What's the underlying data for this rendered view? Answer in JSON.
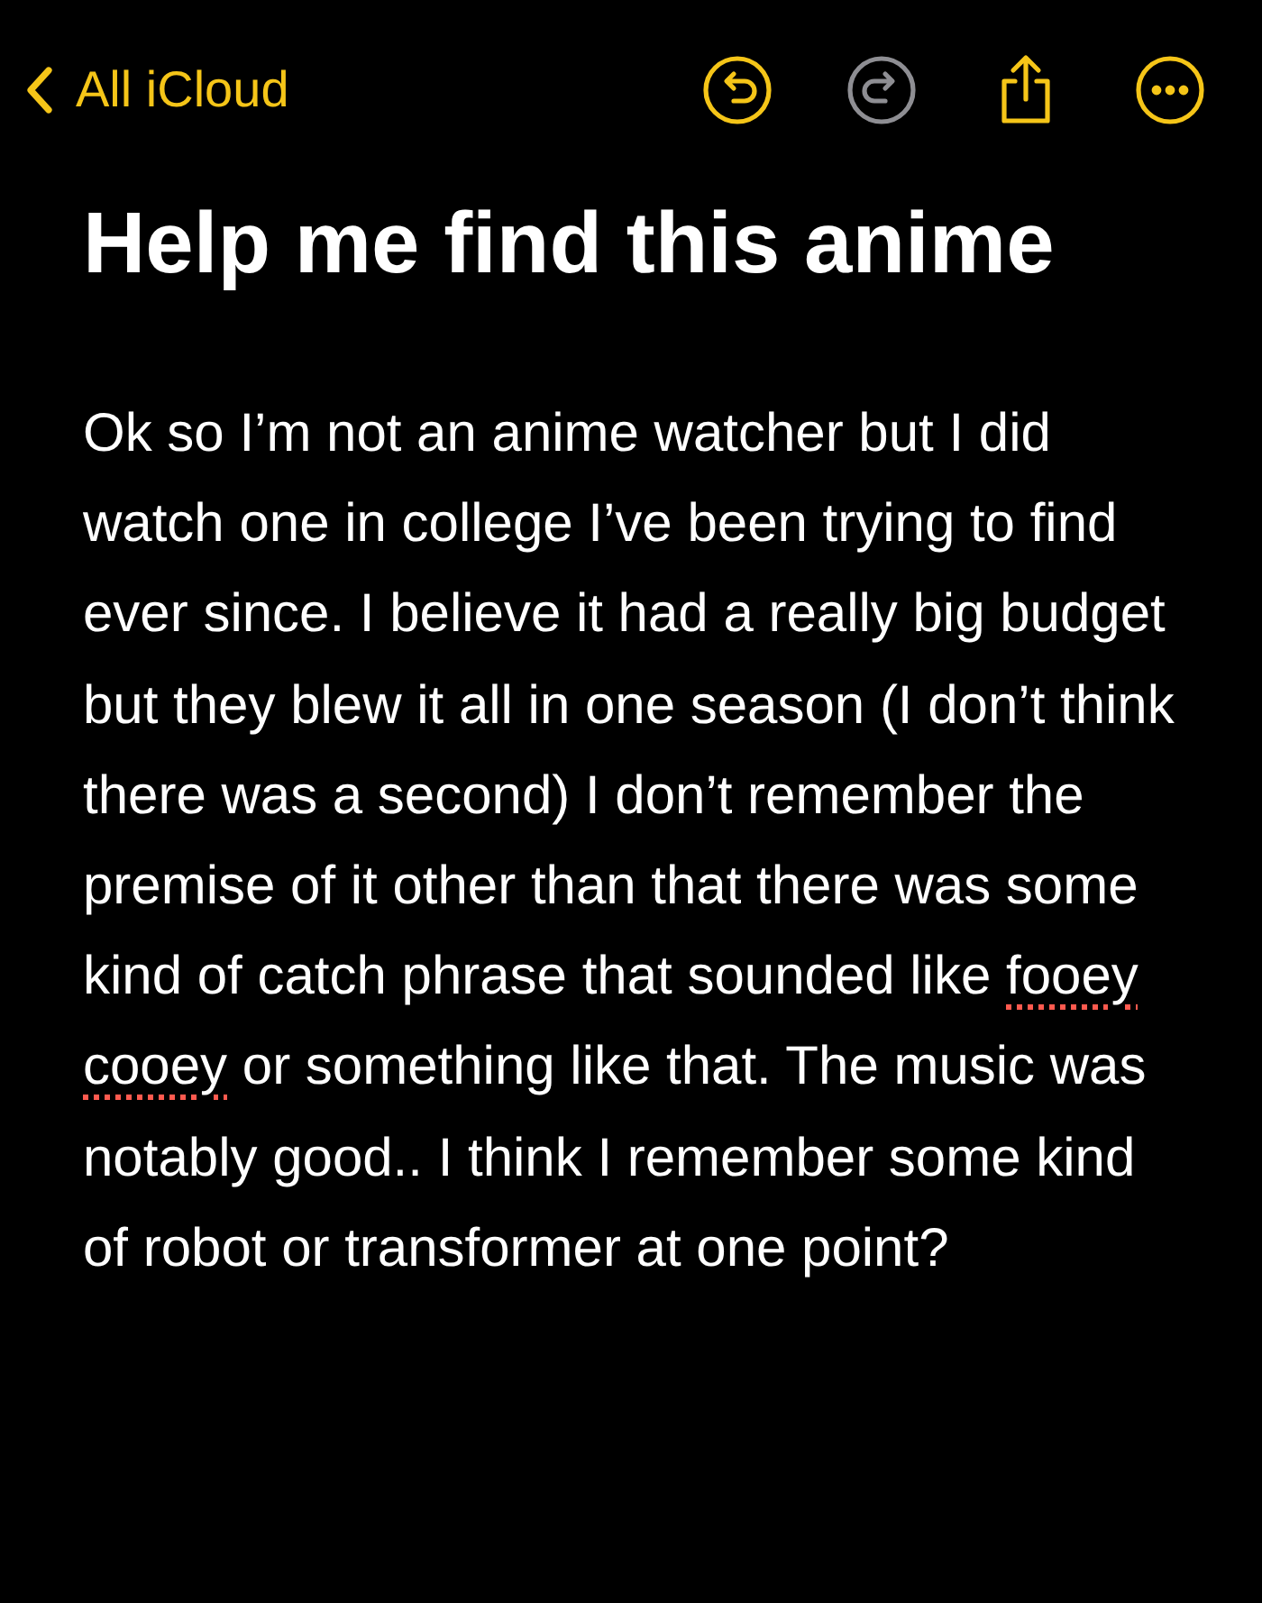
{
  "nav": {
    "back_label": "All iCloud",
    "undo": {
      "disabled": false
    },
    "redo": {
      "disabled": true
    }
  },
  "note": {
    "title": "Help me find this anime",
    "body": [
      {
        "text": "Ok so I’m not an anime watcher but I did watch one in college I’ve been trying to find ever since. I believe it had a really big budget but they blew it all in one season (I don’t think there was a second) I don’t remember the premise of it other than that there was some kind of catch phrase that sounded like",
        "misspelled": false
      },
      {
        "text": "fooey",
        "misspelled": true
      },
      {
        "text": "cooey",
        "misspelled": true
      },
      {
        "text": "or something like that. The music was notably good.. I think I remember some kind of robot or transformer at one point?",
        "misspelled": false
      }
    ]
  }
}
